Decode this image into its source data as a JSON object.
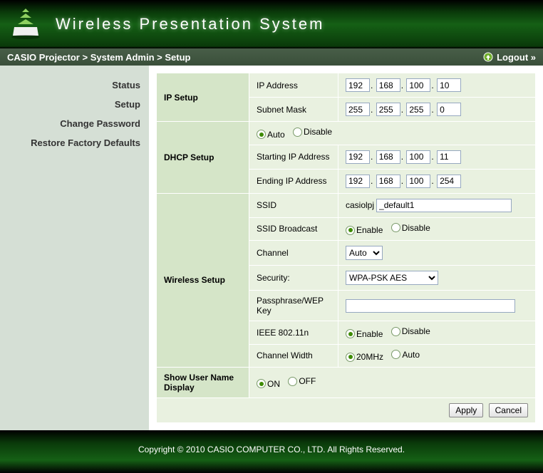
{
  "header": {
    "title": "Wireless Presentation System"
  },
  "breadcrumb": {
    "part1": "CASIO Projector",
    "part2": "System Admin",
    "part3": "Setup",
    "sep": ">",
    "logout": "Logout »"
  },
  "sidebar": {
    "items": [
      {
        "label": "Status"
      },
      {
        "label": "Setup"
      },
      {
        "label": "Change Password"
      },
      {
        "label": "Restore Factory Defaults"
      }
    ]
  },
  "ip_setup": {
    "section": "IP Setup",
    "ip_label": "IP Address",
    "ip": [
      "192",
      "168",
      "100",
      "10"
    ],
    "mask_label": "Subnet Mask",
    "mask": [
      "255",
      "255",
      "255",
      "0"
    ]
  },
  "dhcp": {
    "section": "DHCP Setup",
    "auto": "Auto",
    "disable": "Disable",
    "mode_selected": "auto",
    "start_label": "Starting IP Address",
    "start_ip": [
      "192",
      "168",
      "100",
      "11"
    ],
    "end_label": "Ending IP Address",
    "end_ip": [
      "192",
      "168",
      "100",
      "254"
    ]
  },
  "wifi": {
    "section": "Wireless Setup",
    "ssid_label": "SSID",
    "ssid_prefix": "casiolpj",
    "ssid_value": "_default1",
    "broadcast_label": "SSID Broadcast",
    "enable": "Enable",
    "disable": "Disable",
    "broadcast_selected": "enable",
    "channel_label": "Channel",
    "channel_value": "Auto",
    "security_label": "Security:",
    "security_value": "WPA-PSK AES",
    "passphrase_label": "Passphrase/WEP Key",
    "passphrase_value": "",
    "n_label": "IEEE 802.11n",
    "n_selected": "enable",
    "width_label": "Channel Width",
    "width_20": "20MHz",
    "width_auto": "Auto",
    "width_selected": "20"
  },
  "username": {
    "section": "Show User Name Display",
    "on": "ON",
    "off": "OFF",
    "selected": "on"
  },
  "buttons": {
    "apply": "Apply",
    "cancel": "Cancel"
  },
  "footer": "Copyright © 2010 CASIO COMPUTER CO., LTD. All Rights Reserved."
}
